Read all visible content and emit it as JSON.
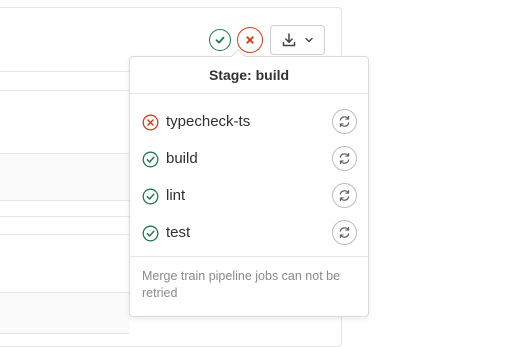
{
  "dropdown": {
    "title": "Stage: build",
    "jobs": [
      {
        "name": "typecheck-ts",
        "status": "failed",
        "icon": "status-failed-icon"
      },
      {
        "name": "build",
        "status": "success",
        "icon": "status-success-icon"
      },
      {
        "name": "lint",
        "status": "success",
        "icon": "status-success-icon"
      },
      {
        "name": "test",
        "status": "success",
        "icon": "status-success-icon"
      }
    ],
    "footer_note": "Merge train pipeline jobs can not be retried"
  },
  "colors": {
    "success": "#1f7a4c",
    "failed": "#d43c1e",
    "border": "#dbdbdb",
    "muted_text": "#8a8a8a"
  },
  "icons": {
    "stage_success": "check-circle-icon",
    "stage_failed": "x-circle-icon",
    "artifacts": "download-icon",
    "artifacts_caret": "chevron-down-icon",
    "retry": "retry-icon"
  }
}
